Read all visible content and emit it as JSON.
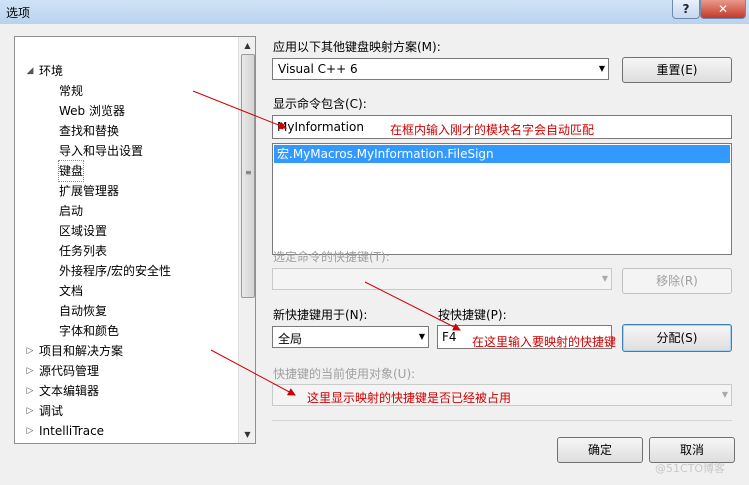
{
  "window": {
    "title": "选项",
    "help_label": "?",
    "close_label": "✕"
  },
  "tree": {
    "items": [
      {
        "label": "环境",
        "expanded": true
      },
      {
        "label": "常规"
      },
      {
        "label": "Web 浏览器"
      },
      {
        "label": "查找和替换"
      },
      {
        "label": "导入和导出设置"
      },
      {
        "label": "键盘",
        "selected": true
      },
      {
        "label": "扩展管理器"
      },
      {
        "label": "启动"
      },
      {
        "label": "区域设置"
      },
      {
        "label": "任务列表"
      },
      {
        "label": "外接程序/宏的安全性"
      },
      {
        "label": "文档"
      },
      {
        "label": "自动恢复"
      },
      {
        "label": "字体和颜色"
      },
      {
        "label": "项目和解决方案",
        "collapsed": true
      },
      {
        "label": "源代码管理",
        "collapsed": true
      },
      {
        "label": "文本编辑器",
        "collapsed": true
      },
      {
        "label": "调试",
        "collapsed": true
      },
      {
        "label": "IntelliTrace",
        "collapsed": true
      }
    ]
  },
  "keyboard": {
    "mapping_label": "应用以下其他键盘映射方案(M):",
    "mapping_value": "Visual C++ 6",
    "reset_label": "重置(E)",
    "show_commands_label": "显示命令包含(C):",
    "command_filter_value": "MyInformation",
    "command_list": [
      "宏.MyMacros.MyInformation.FileSign"
    ],
    "shortcuts_for_label": "选定命令的快捷键(T):",
    "remove_label": "移除(R)",
    "new_shortcut_in_label": "新快捷键用于(N):",
    "scope_value": "全局",
    "press_keys_label": "按快捷键(P):",
    "shortcut_value": "F4",
    "assign_label": "分配(S)",
    "currently_used_label": "快捷键的当前使用对象(U):"
  },
  "annotations": {
    "filter_note": "在框内输入刚才的模块名字会自动匹配",
    "shortcut_note": "在这里输入要映射的快捷键",
    "usage_note": "这里显示映射的快捷键是否已经被占用"
  },
  "dialog_buttons": {
    "ok_label": "确定",
    "cancel_label": "取消"
  },
  "watermark": "@51CTO博客",
  "colors": {
    "annotation": "#d00000",
    "selection": "#3399ff"
  }
}
